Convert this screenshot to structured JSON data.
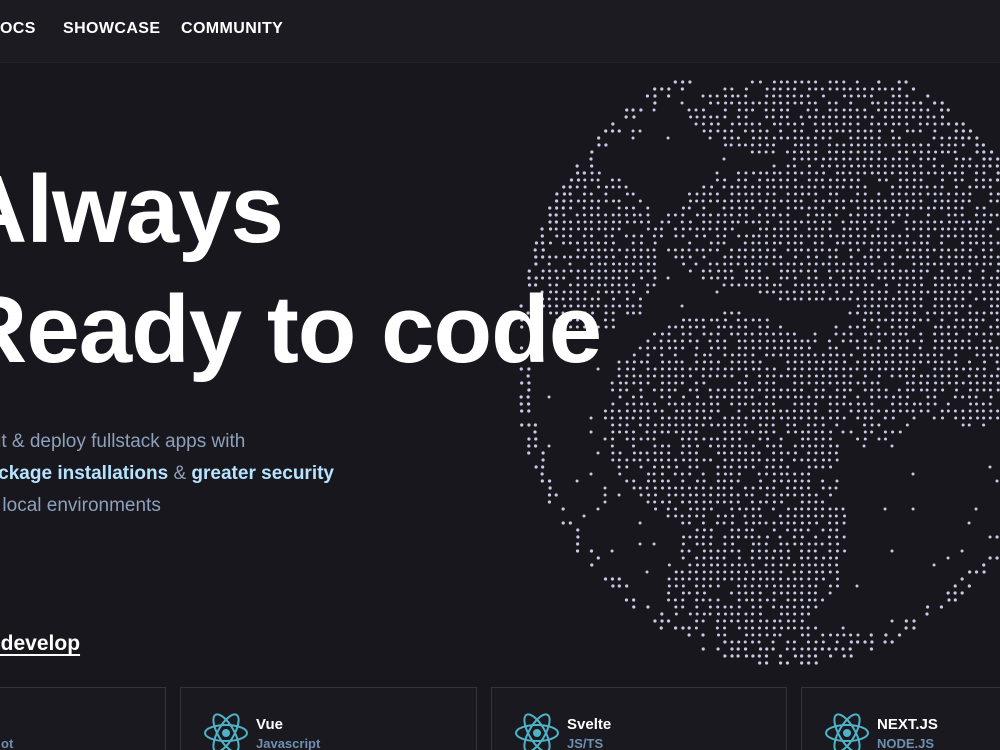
{
  "nav": {
    "items": [
      {
        "label": "DOCS"
      },
      {
        "label": "SHOWCASE"
      },
      {
        "label": "COMMUNITY"
      }
    ]
  },
  "hero": {
    "title_line1": "Always",
    "title_line2": "Ready to code",
    "subtitle_line1": "edit & deploy fullstack apps with",
    "subtitle_hl1": "package installations",
    "subtitle_amp": " & ",
    "subtitle_hl2": "greater security",
    "subtitle_line3": "en local environments",
    "cta": "d develop"
  },
  "templates": [
    {
      "title": "",
      "subtitle": "ot",
      "icon": "none"
    },
    {
      "title": "Vue",
      "subtitle": "Javascript",
      "icon": "react-atom-icon"
    },
    {
      "title": "Svelte",
      "subtitle": "JS/TS",
      "icon": "react-atom-icon"
    },
    {
      "title": "NEXT.JS",
      "subtitle": "NODE.JS",
      "icon": "react-atom-icon"
    }
  ],
  "colors": {
    "background": "#18171d",
    "navbar": "#1c1b21",
    "highlight": "#b6e3ff",
    "subtitle": "#8ea0bb",
    "globe_dots": "#c9c9e6",
    "icon": "#4fb3c8"
  }
}
